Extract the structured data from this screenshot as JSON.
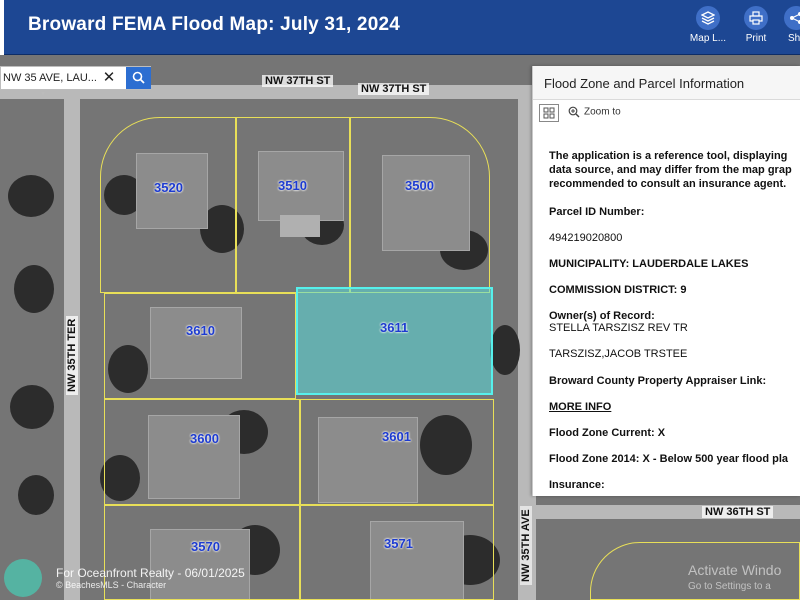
{
  "header": {
    "title": "Broward FEMA Flood Map:  July 31, 2024",
    "buttons": [
      {
        "label": "Map L...",
        "icon": "layers-icon"
      },
      {
        "label": "Print",
        "icon": "print-icon"
      },
      {
        "label": "Sh",
        "icon": "share-icon"
      }
    ]
  },
  "search": {
    "value": "NW 35 AVE, LAU..."
  },
  "map": {
    "streets": {
      "nw37_left": "NW 37TH ST",
      "nw37_right": "NW 37TH ST",
      "nw36": "NW 36TH ST",
      "nw35ter": "NW 35TH TER",
      "nw35ave": "NW 35TH AVE"
    },
    "parcels": [
      "3520",
      "3510",
      "3500",
      "3610",
      "3611",
      "3600",
      "3601",
      "3570",
      "3571"
    ],
    "selected_parcel": "3611",
    "colors": {
      "selection": "#56f0ec",
      "parcel_line": "#e8df58",
      "parcel_label": "#1d3bd0"
    }
  },
  "panel": {
    "title": "Flood Zone and Parcel Information",
    "zoom_to": "Zoom to",
    "disclaimer": [
      "The application is a reference tool, displaying",
      "data source, and may differ from the map grap",
      "recommended to consult an insurance agent."
    ],
    "parcel_id_label": "Parcel ID Number:",
    "parcel_id_value": "494219020800",
    "municipality": "MUNICIPALITY: LAUDERDALE LAKES",
    "commission_district": "COMMISSION DISTRICT: 9",
    "owners_label": "Owner(s) of Record:",
    "owner_1": "STELLA TARSZISZ REV TR",
    "owner_2": "TARSZISZ,JACOB TRSTEE",
    "appraiser_label": "Broward County Property Appraiser Link:",
    "more_info": "MORE INFO",
    "flood_zone_current": "Flood Zone Current: X",
    "flood_zone_2014": "Flood Zone 2014: X - Below 500 year flood pla",
    "insurance_label": "Insurance:"
  },
  "watermarks": {
    "brokerage": "For Oceanfront Realty - 06/01/2025",
    "mls": "© BeachesMLS - Character",
    "windows_line1": "Activate Windo",
    "windows_line2": "Go to Settings to a"
  },
  "colors": {
    "header_bg": "#1d4793",
    "accent": "#2c6ed1"
  }
}
